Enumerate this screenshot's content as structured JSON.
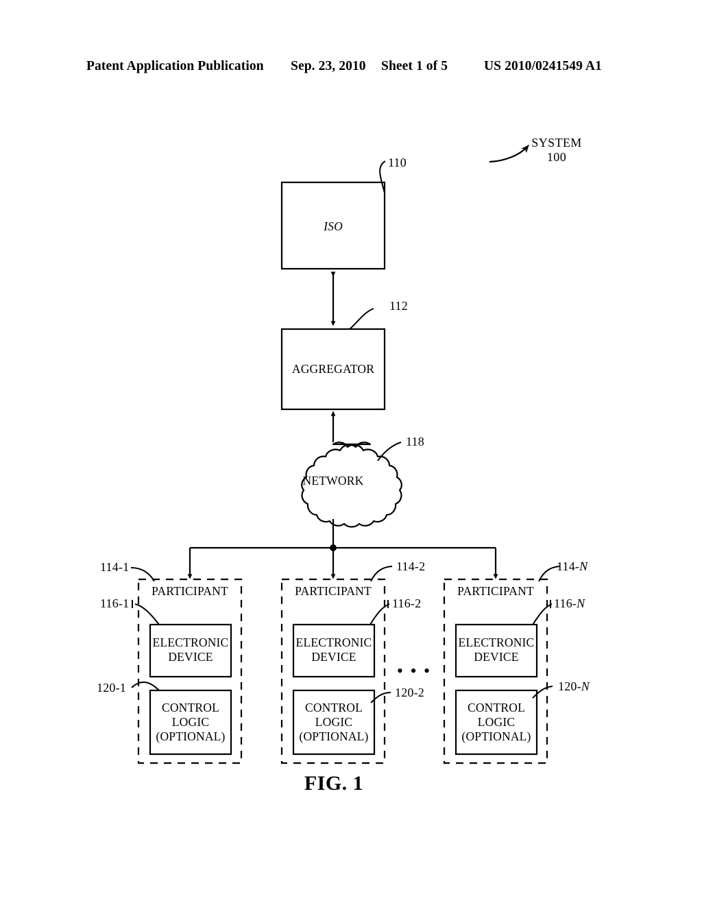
{
  "header": {
    "publication": "Patent Application Publication",
    "date": "Sep. 23, 2010",
    "sheet": "Sheet 1 of 5",
    "patent_number": "US 2010/0241549 A1"
  },
  "figure": {
    "caption": "FIG. 1",
    "system_label": {
      "name": "SYSTEM",
      "number": "100"
    },
    "nodes": {
      "iso": {
        "label": "ISO",
        "ref": "110"
      },
      "aggregator": {
        "label": "AGGREGATOR",
        "ref": "112"
      },
      "network": {
        "label": "NETWORK",
        "ref": "118"
      }
    },
    "participants": [
      {
        "label": "PARTICIPANT",
        "ref": "114-1",
        "device": {
          "line1": "ELECTRONIC",
          "line2": "DEVICE",
          "ref": "116-1"
        },
        "control": {
          "line1": "CONTROL",
          "line2": "LOGIC",
          "line3": "(OPTIONAL)",
          "ref": "120-1"
        }
      },
      {
        "label": "PARTICIPANT",
        "ref": "114-2",
        "device": {
          "line1": "ELECTRONIC",
          "line2": "DEVICE",
          "ref": "116-2"
        },
        "control": {
          "line1": "CONTROL",
          "line2": "LOGIC",
          "line3": "(OPTIONAL)",
          "ref": "120-2"
        }
      },
      {
        "label": "PARTICIPANT",
        "ref_prefix": "114-",
        "ref_suffix": "N",
        "device": {
          "line1": "ELECTRONIC",
          "line2": "DEVICE",
          "ref_prefix": "116-",
          "ref_suffix": "N"
        },
        "control": {
          "line1": "CONTROL",
          "line2": "LOGIC",
          "line3": "(OPTIONAL)",
          "ref_prefix": "120-",
          "ref_suffix": "N"
        }
      }
    ],
    "ellipsis": "• • •"
  },
  "colors": {
    "ink": "#000000",
    "paper": "#ffffff"
  }
}
